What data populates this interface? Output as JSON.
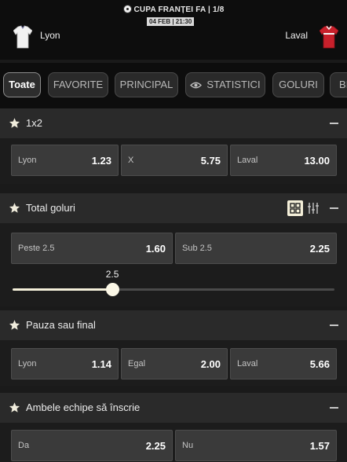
{
  "header": {
    "competition": "CUPA FRANȚEI FA | 1/8",
    "datetime": "04 FEB | 21:30",
    "home_team": "Lyon",
    "away_team": "Laval"
  },
  "tabs": [
    "Toate",
    "FAVORITE",
    "PRINCIPAL",
    "STATISTICI",
    "GOLURI",
    "BI"
  ],
  "active_tab": "Toate",
  "markets": {
    "result": {
      "title": "1x2",
      "options": [
        {
          "label": "Lyon",
          "odd": "1.23"
        },
        {
          "label": "X",
          "odd": "5.75"
        },
        {
          "label": "Laval",
          "odd": "13.00"
        }
      ]
    },
    "total_goals": {
      "title": "Total goluri",
      "options": [
        {
          "label": "Peste 2.5",
          "odd": "1.60"
        },
        {
          "label": "Sub 2.5",
          "odd": "2.25"
        }
      ],
      "line_value": "2.5",
      "line_fraction": 0.31
    },
    "halftime_fulltime": {
      "title": "Pauza sau final",
      "options": [
        {
          "label": "Lyon",
          "odd": "1.14"
        },
        {
          "label": "Egal",
          "odd": "2.00"
        },
        {
          "label": "Laval",
          "odd": "5.66"
        }
      ]
    },
    "both_teams_score": {
      "title": "Ambele echipe să înscrie",
      "options": [
        {
          "label": "Da",
          "odd": "2.25"
        },
        {
          "label": "Nu",
          "odd": "1.57"
        }
      ]
    }
  },
  "colors": {
    "accent": "#f4efd9",
    "background": "#1a1a1a",
    "header_bg": "#0d0d0d",
    "odd_button": "#3a3a3a"
  },
  "icons": [
    "soccer-ball-icon",
    "home-jersey-icon",
    "away-jersey-icon",
    "eye-icon",
    "star-icon",
    "collapse-icon",
    "grid-view-icon",
    "list-view-icon"
  ]
}
